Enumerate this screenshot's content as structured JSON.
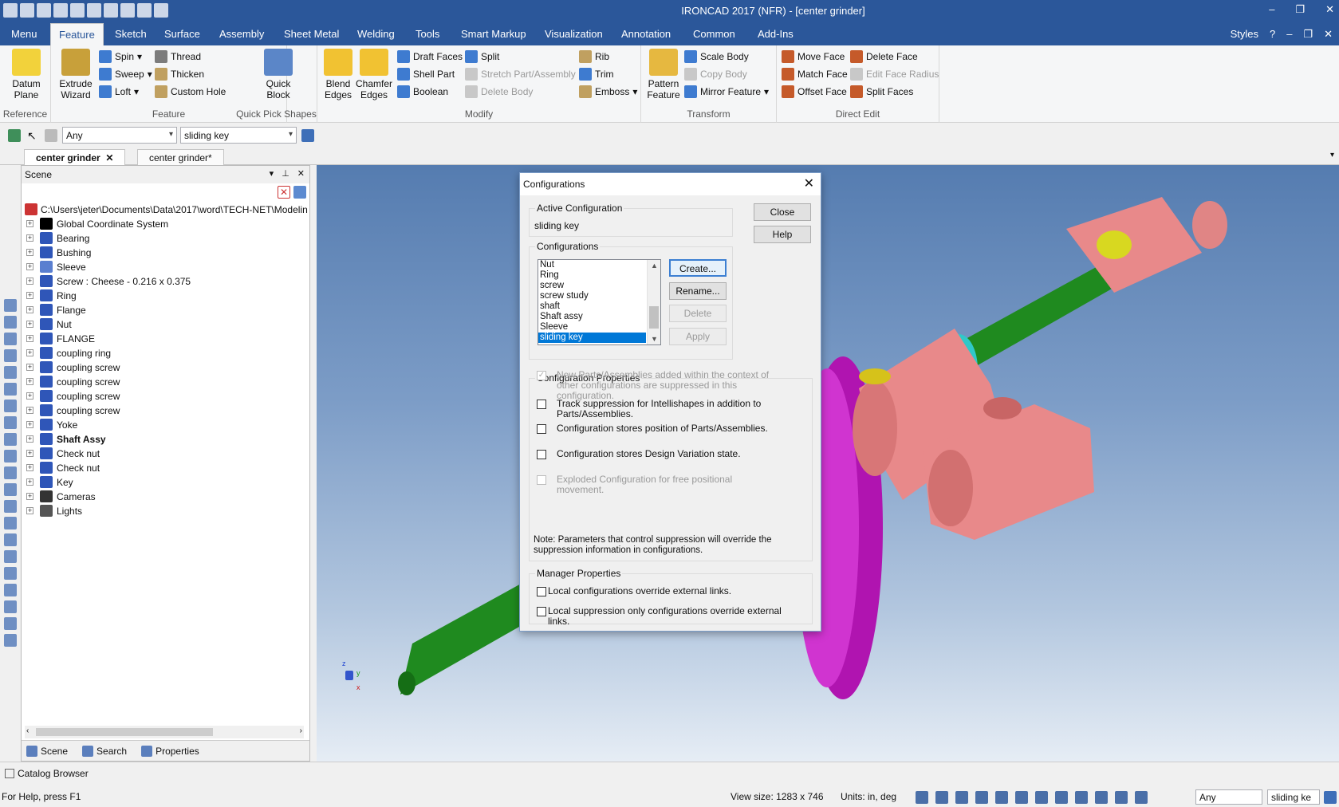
{
  "app": {
    "title": "IRONCAD 2017 (NFR) - [center grinder]",
    "window_controls": [
      "–",
      "❐",
      "✕"
    ]
  },
  "ribbon_tabs": [
    "Menu",
    "Feature",
    "Sketch",
    "Surface",
    "Assembly",
    "Sheet Metal",
    "Welding",
    "Tools",
    "Smart Markup",
    "Visualization",
    "Annotation",
    "Common",
    "Add-Ins"
  ],
  "ribbon_right": {
    "styles": "Styles",
    "help_icon": "help-icon"
  },
  "ribbon": {
    "reference": {
      "label": "Reference",
      "datum_plane": "Datum Plane"
    },
    "feature": {
      "label": "Feature",
      "extrude_wizard": "Extrude Wizard",
      "spin": "Spin",
      "sweep": "Sweep",
      "loft": "Loft",
      "thread": "Thread",
      "thicken": "Thicken",
      "custom_hole": "Custom Hole"
    },
    "quick_pick": {
      "label": "Quick Pick Shapes",
      "quick_block": "Quick Block"
    },
    "modify": {
      "label": "Modify",
      "blend_edges": "Blend Edges",
      "chamfer_edges": "Chamfer Edges",
      "draft_faces": "Draft Faces",
      "shell_part": "Shell Part",
      "boolean": "Boolean",
      "split": "Split",
      "stretch": "Stretch Part/Assembly",
      "delete_body": "Delete Body",
      "rib": "Rib",
      "trim": "Trim",
      "emboss": "Emboss"
    },
    "transform": {
      "label": "Transform",
      "pattern_feature": "Pattern Feature",
      "scale_body": "Scale Body",
      "copy_body": "Copy Body",
      "mirror_feature": "Mirror Feature"
    },
    "direct_edit": {
      "label": "Direct Edit",
      "move_face": "Move Face",
      "match_face": "Match Face",
      "offset_face": "Offset Face",
      "delete_face": "Delete Face",
      "edit_face_radius": "Edit Face Radius",
      "split_faces": "Split Faces"
    }
  },
  "toolbar2": {
    "filter": "Any",
    "config": "sliding key"
  },
  "doc_tabs": [
    "center grinder",
    "center grinder*"
  ],
  "scene": {
    "title": "Scene",
    "root": "C:\\Users\\jeter\\Documents\\Data\\2017\\word\\TECH-NET\\Modelin",
    "items": [
      "Global Coordinate System",
      "Bearing",
      "Bushing",
      "Sleeve",
      "Screw : Cheese - 0.216 x 0.375",
      "Ring",
      "Flange",
      "Nut",
      "FLANGE",
      "coupling ring",
      "coupling screw",
      "coupling screw",
      "coupling screw",
      "coupling screw",
      "Yoke",
      "Shaft Assy",
      "Check nut",
      "Check nut",
      "Key",
      "Cameras",
      "Lights"
    ],
    "tabs": [
      "Scene",
      "Search",
      "Properties"
    ]
  },
  "dialog": {
    "title": "Configurations",
    "active_label": "Active Configuration",
    "active_value": "sliding key",
    "configs_label": "Configurations",
    "configs": [
      "Nut",
      "Ring",
      "screw",
      "screw study",
      "shaft",
      "Shaft assy",
      "Sleeve",
      "sliding key"
    ],
    "selected": "sliding key",
    "buttons": {
      "close": "Close",
      "help": "Help",
      "create": "Create...",
      "rename": "Rename...",
      "delete": "Delete",
      "apply": "Apply"
    },
    "props_label": "Configuration Properties",
    "props": [
      {
        "text": "New Parts/Assemblies added within the context of other configurations are suppressed in this configuration.",
        "checked": true,
        "disabled": true
      },
      {
        "text": "Track suppression for Intellishapes in addition to Parts/Assemblies.",
        "checked": false,
        "disabled": false
      },
      {
        "text": "Configuration stores position of Parts/Assemblies.",
        "checked": false,
        "disabled": false
      },
      {
        "text": "Configuration stores Design Variation state.",
        "checked": false,
        "disabled": false
      },
      {
        "text": "Exploded Configuration for free positional movement.",
        "checked": false,
        "disabled": true
      }
    ],
    "note": "Note: Parameters that control suppression will override the suppression information in configurations.",
    "manager_label": "Manager Properties",
    "manager": [
      "Local configurations override external links.",
      "Local suppression only configurations override external links."
    ]
  },
  "status": {
    "catalog": "Catalog Browser",
    "help": "For Help, press F1",
    "view_size": "View size: 1283 x 746",
    "units": "Units: in, deg",
    "filter": "Any",
    "config": "sliding ke"
  },
  "axis": {
    "z": "z",
    "y": "y",
    "x": "x"
  },
  "colors": {
    "accent": "#2b579a",
    "part_pink": "#e8898a",
    "shaft_green": "#1f8a1f",
    "flange_magenta": "#c820c8",
    "ring_cyan": "#30c8c8",
    "yellow": "#d8d820"
  }
}
